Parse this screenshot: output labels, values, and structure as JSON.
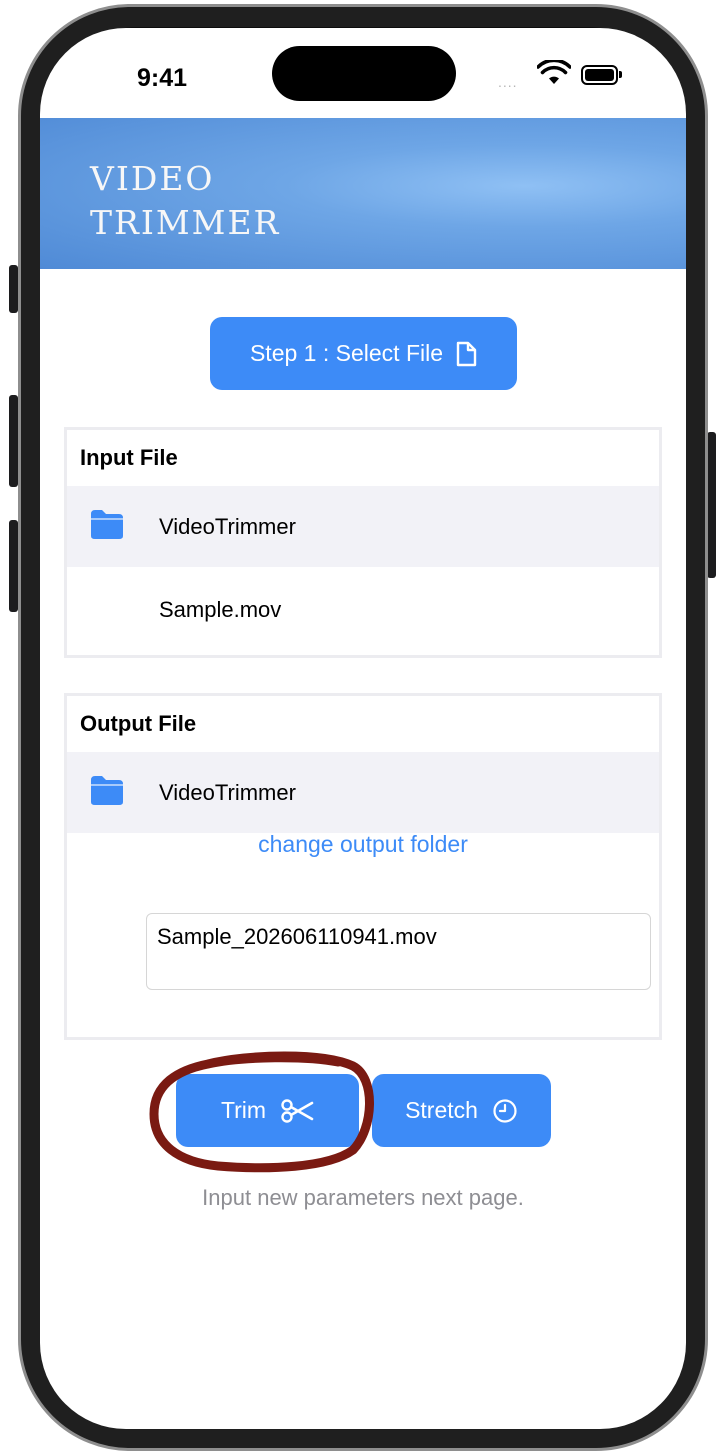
{
  "status_bar": {
    "time": "9:41",
    "signal": "....",
    "icons": [
      "wifi-icon",
      "battery-icon"
    ]
  },
  "banner": {
    "logo_line1": "Video",
    "logo_line2": "Trimmer"
  },
  "select_button": {
    "label": "Step 1 : Select File",
    "icon": "document-icon"
  },
  "input_section": {
    "title": "Input File",
    "folder_name": "VideoTrimmer",
    "file_name": "Sample.mov",
    "icon": "folder-icon"
  },
  "output_section": {
    "title": "Output File",
    "folder_name": "VideoTrimmer",
    "change_folder_label": "change output folder",
    "file_name": "Sample_202606110941.mov",
    "icon": "folder-icon"
  },
  "actions": {
    "trim_label": "Trim",
    "trim_icon": "scissors-icon",
    "stretch_label": "Stretch",
    "stretch_icon": "clock-icon"
  },
  "hint": "Input new parameters next page.",
  "colors": {
    "accent": "#3d8bf7",
    "banner": "#6ea6e6",
    "annotation": "#7a1a12"
  }
}
